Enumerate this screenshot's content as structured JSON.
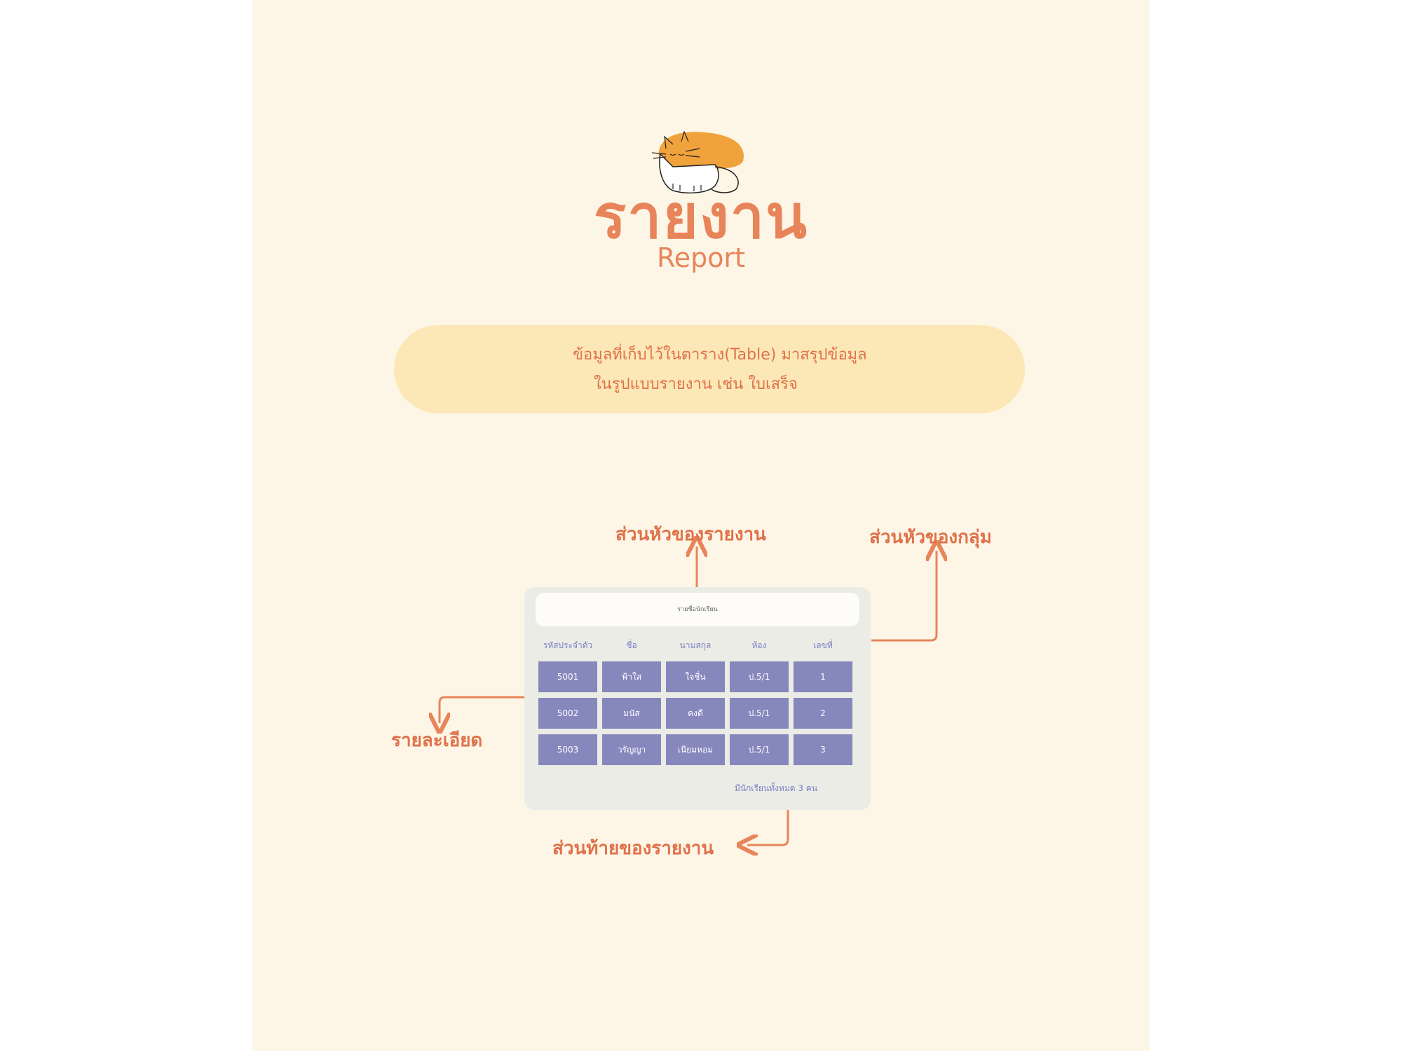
{
  "title": "รายงาน",
  "subtitle": "Report",
  "description": {
    "line1": "ข้อมูลที่เก็บไว้ในตาราง(Table) มาสรุปข้อมูล",
    "line2": "ในรูปแบบรายงาน เช่น ใบเสร็จ"
  },
  "labels": {
    "report_header": "ส่วนหัวของรายงาน",
    "group_header": "ส่วนหัวของกลุ่ม",
    "detail": "รายละเอียด",
    "report_footer": "ส่วนท้ายของรายงาน"
  },
  "report": {
    "header_text": "รายชื่อนักเรียน",
    "columns": [
      "รหัสประจำตัว",
      "ชื่อ",
      "นามสกุล",
      "ห้อง",
      "เลขที่"
    ],
    "rows": [
      [
        "5001",
        "ฟ้าใส",
        "ใจชื่น",
        "ป.5/1",
        "1"
      ],
      [
        "5002",
        "มนัส",
        "คงดี",
        "ป.5/1",
        "2"
      ],
      [
        "5003",
        "วรัญญา",
        "เนียมหอม",
        "ป.5/1",
        "3"
      ]
    ],
    "footer_text": "มีนักเรียนทั้งหมด 3 คน"
  },
  "colors": {
    "background": "#fdf6e6",
    "accent": "#e8845a",
    "box": "#fce8b6",
    "cell": "#8587bd",
    "cell_text": "#7a7fc4"
  }
}
